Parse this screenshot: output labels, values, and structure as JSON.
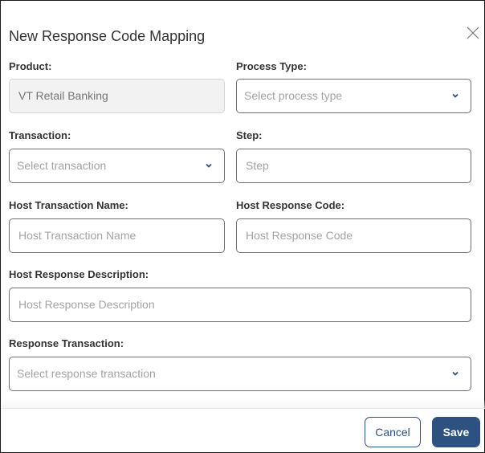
{
  "dialog": {
    "title": "New Response Code Mapping",
    "close_icon": "close-icon"
  },
  "form": {
    "product": {
      "label": "Product:",
      "value": "VT Retail Banking",
      "disabled": true
    },
    "process_type": {
      "label": "Process Type:",
      "placeholder": "Select process type",
      "icon": "chevron-down-icon"
    },
    "transaction": {
      "label": "Transaction:",
      "placeholder": "Select transaction",
      "icon": "chevron-down-icon"
    },
    "step": {
      "label": "Step:",
      "placeholder": "Step"
    },
    "host_transaction_name": {
      "label": "Host Transaction Name:",
      "placeholder": "Host Transaction Name"
    },
    "host_response_code": {
      "label": "Host Response Code:",
      "placeholder": "Host Response Code"
    },
    "host_response_description": {
      "label": "Host Response Description:",
      "placeholder": "Host Response Description"
    },
    "response_transaction": {
      "label": "Response Transaction:",
      "placeholder": "Select response transaction",
      "icon": "chevron-down-icon"
    }
  },
  "footer": {
    "cancel_label": "Cancel",
    "save_label": "Save"
  },
  "colors": {
    "primary": "#2d5282",
    "chevron": "#2d4f7c"
  }
}
